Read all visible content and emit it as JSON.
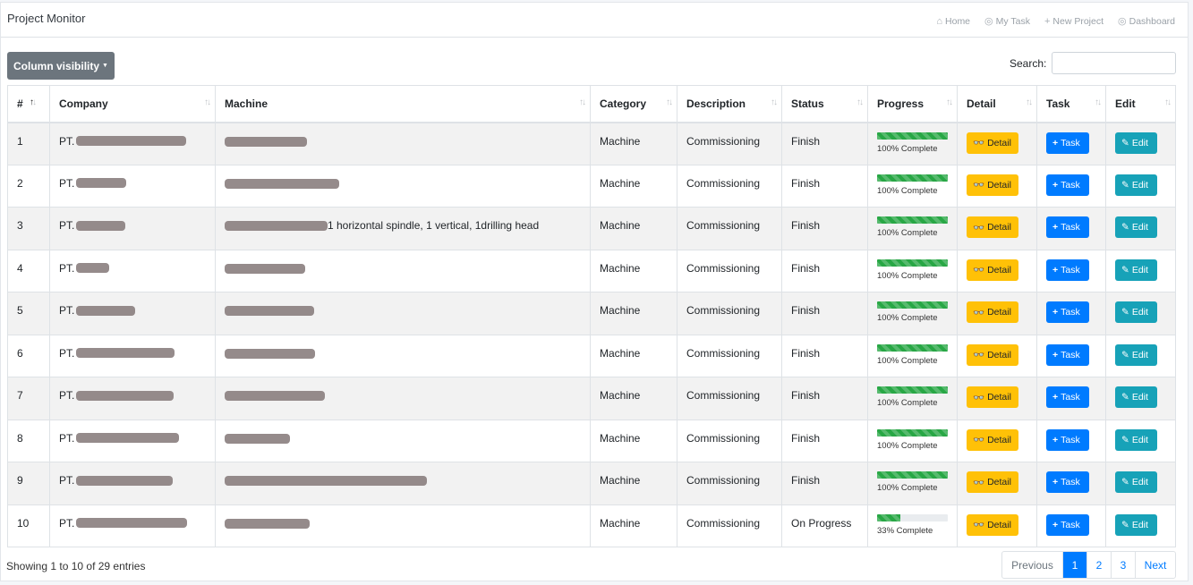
{
  "app": {
    "title": "Project Monitor",
    "nav": [
      {
        "icon": "home-icon",
        "glyph": "⌂",
        "label": "Home"
      },
      {
        "icon": "tachometer-icon",
        "glyph": "◎",
        "label": "My Task"
      },
      {
        "icon": "plus-icon",
        "glyph": "+",
        "label": "New Project"
      },
      {
        "icon": "dashboard-icon",
        "glyph": "◎",
        "label": "Dashboard"
      }
    ]
  },
  "toolbar": {
    "column_visibility": "Column visibility",
    "search_label": "Search:",
    "search_value": ""
  },
  "table": {
    "headers": [
      "#",
      "Company",
      "Machine",
      "Category",
      "Description",
      "Status",
      "Progress",
      "Detail",
      "Task",
      "Edit"
    ],
    "rows": [
      {
        "no": "1",
        "company": "PT.",
        "company_redact": 123,
        "machine_prefix": "",
        "machine_redact": 92,
        "machine_suffix": "",
        "category": "Machine",
        "description": "Commissioning",
        "status": "Finish",
        "progress": 100,
        "progress_text": "100% Complete"
      },
      {
        "no": "2",
        "company": "PT.",
        "company_redact": 56,
        "machine_prefix": "",
        "machine_redact": 128,
        "machine_suffix": "",
        "category": "Machine",
        "description": "Commissioning",
        "status": "Finish",
        "progress": 100,
        "progress_text": "100% Complete"
      },
      {
        "no": "3",
        "company": "PT.",
        "company_redact": 55,
        "machine_prefix": "",
        "machine_redact": 115,
        "machine_suffix": "1 horizontal spindle, 1 vertical, 1drilling head",
        "category": "Machine",
        "description": "Commissioning",
        "status": "Finish",
        "progress": 100,
        "progress_text": "100% Complete"
      },
      {
        "no": "4",
        "company": "PT.",
        "company_redact": 37,
        "machine_prefix": "",
        "machine_redact": 90,
        "machine_suffix": "",
        "category": "Machine",
        "description": "Commissioning",
        "status": "Finish",
        "progress": 100,
        "progress_text": "100% Complete"
      },
      {
        "no": "5",
        "company": "PT.",
        "company_redact": 66,
        "machine_prefix": "",
        "machine_redact": 100,
        "machine_suffix": "",
        "category": "Machine",
        "description": "Commissioning",
        "status": "Finish",
        "progress": 100,
        "progress_text": "100% Complete"
      },
      {
        "no": "6",
        "company": "PT.",
        "company_redact": 110,
        "machine_prefix": "",
        "machine_redact": 101,
        "machine_suffix": "",
        "category": "Machine",
        "description": "Commissioning",
        "status": "Finish",
        "progress": 100,
        "progress_text": "100% Complete"
      },
      {
        "no": "7",
        "company": "PT.",
        "company_redact": 109,
        "machine_prefix": "",
        "machine_redact": 112,
        "machine_suffix": "",
        "category": "Machine",
        "description": "Commissioning",
        "status": "Finish",
        "progress": 100,
        "progress_text": "100% Complete"
      },
      {
        "no": "8",
        "company": "PT.",
        "company_redact": 115,
        "machine_prefix": "",
        "machine_redact": 73,
        "machine_suffix": "",
        "category": "Machine",
        "description": "Commissioning",
        "status": "Finish",
        "progress": 100,
        "progress_text": "100% Complete"
      },
      {
        "no": "9",
        "company": "PT.",
        "company_redact": 108,
        "machine_prefix": "",
        "machine_redact": 226,
        "machine_suffix": "",
        "category": "Machine",
        "description": "Commissioning",
        "status": "Finish",
        "progress": 100,
        "progress_text": "100% Complete"
      },
      {
        "no": "10",
        "company": "PT.",
        "company_redact": 124,
        "machine_prefix": "",
        "machine_redact": 95,
        "machine_suffix": "",
        "category": "Machine",
        "description": "Commissioning",
        "status": "On Progress",
        "progress": 33,
        "progress_text": "33% Complete"
      }
    ],
    "actions": {
      "detail": "Detail",
      "task": "Task",
      "edit": "Edit"
    }
  },
  "footer": {
    "info": "Showing 1 to 10 of 29 entries",
    "previous": "Previous",
    "pages": [
      "1",
      "2",
      "3"
    ],
    "active_page": "1",
    "next": "Next"
  },
  "colors": {
    "primary": "#007bff",
    "warning": "#ffc107",
    "info": "#17a2b8",
    "success": "#28a745",
    "secondary": "#6c757d"
  }
}
